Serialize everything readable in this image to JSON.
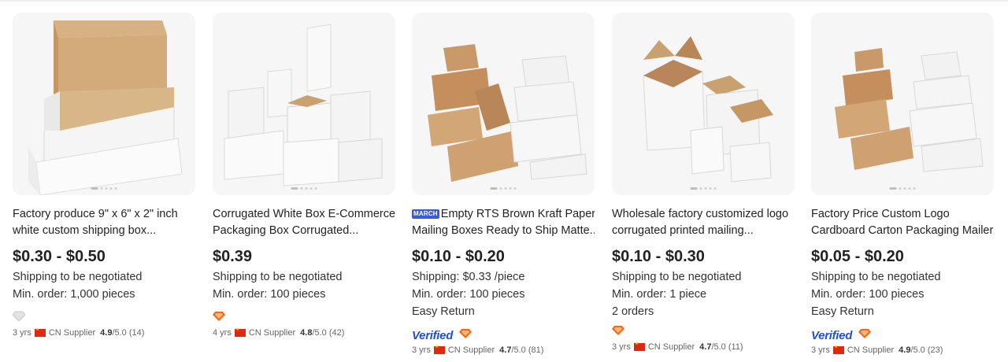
{
  "products": [
    {
      "title_lines": [
        "Factory produce 9\" x 6\" x 2\" inch",
        "white custom shipping box..."
      ],
      "promo_badge": "",
      "price": "$0.30 - $0.50",
      "shipping": "Shipping to be negotiated",
      "min_order": "Min. order: 1,000 pieces",
      "extra": "",
      "verified_label": "",
      "supplier_badge_icon": "diamond-gray-icon",
      "years": "3 yrs",
      "country": "CN Supplier",
      "rating": "4.9",
      "rating_max": "/5.0",
      "reviews": "(14)"
    },
    {
      "title_lines": [
        "Corrugated White Box E-Commerce",
        "Packaging Box Corrugated..."
      ],
      "promo_badge": "",
      "price": "$0.39",
      "shipping": "Shipping to be negotiated",
      "min_order": "Min. order: 100 pieces",
      "extra": "",
      "verified_label": "",
      "supplier_badge_icon": "diamond-orange-icon",
      "years": "4 yrs",
      "country": "CN Supplier",
      "rating": "4.8",
      "rating_max": "/5.0",
      "reviews": "(42)"
    },
    {
      "title_lines": [
        "Empty RTS Brown Kraft Paper",
        "Mailing Boxes Ready to Ship Matte..."
      ],
      "promo_badge": "MARCH",
      "price": "$0.10 - $0.20",
      "shipping": "Shipping: $0.33 /piece",
      "min_order": "Min. order: 100 pieces",
      "extra": "Easy Return",
      "verified_label": "Verified",
      "supplier_badge_icon": "diamond-orange-icon",
      "years": "3 yrs",
      "country": "CN Supplier",
      "rating": "4.7",
      "rating_max": "/5.0",
      "reviews": "(81)"
    },
    {
      "title_lines": [
        "Wholesale factory customized logo",
        "corrugated printed mailing..."
      ],
      "promo_badge": "",
      "price": "$0.10 - $0.30",
      "shipping": "Shipping to be negotiated",
      "min_order": "Min. order: 1 piece",
      "extra": "2 orders",
      "verified_label": "",
      "supplier_badge_icon": "diamond-orange-icon",
      "years": "3 yrs",
      "country": "CN Supplier",
      "rating": "4.7",
      "rating_max": "/5.0",
      "reviews": "(11)"
    },
    {
      "title_lines": [
        "Factory Price Custom Logo",
        "Cardboard Carton Packaging Mailer..."
      ],
      "promo_badge": "",
      "price": "$0.05 - $0.20",
      "shipping": "Shipping to be negotiated",
      "min_order": "Min. order: 100 pieces",
      "extra": "Easy Return",
      "verified_label": "Verified",
      "supplier_badge_icon": "diamond-orange-icon",
      "years": "3 yrs",
      "country": "CN Supplier",
      "rating": "4.9",
      "rating_max": "/5.0",
      "reviews": "(23)"
    }
  ],
  "colors": {
    "kraft": "#c9a06f",
    "white_box": "#f2f2f2",
    "verified_blue": "#1f4fd6",
    "badge_orange": "#f06a1c"
  }
}
